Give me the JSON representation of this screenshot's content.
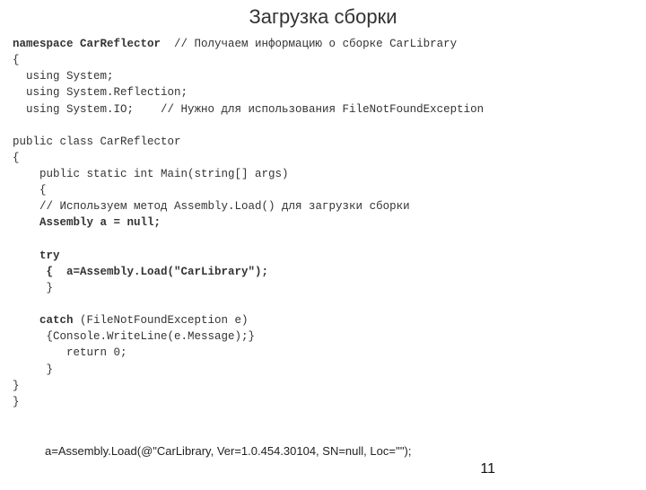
{
  "title": "Загрузка сборки",
  "code": {
    "l1a": "namespace CarReflector",
    "l1b": "  // Получаем информацию о сборке CarLibrary",
    "l2": "{",
    "l3": "  using System;",
    "l4": "  using System.Reflection;",
    "l5": "  using System.IO;    // Нужно для использования FileNotFoundException",
    "l6": "",
    "l7": "public class CarReflector",
    "l8": "{",
    "l9": "    public static int Main(string[] args)",
    "l10": "    {",
    "l11": "    // Используем метод Assembly.Load() для загрузки сборки",
    "l12": "    Assembly a = null;",
    "l13": "",
    "l14": "    try",
    "l15": "     {  a=Assembly.Load(\"CarLibrary\");",
    "l16": "     }",
    "l17": "",
    "l18": "    catch",
    "l18b": " (FileNotFoundException e)",
    "l19": "     {Console.WriteLine(e.Message);}",
    "l20": "        return 0;",
    "l21": "     }",
    "l22": "}",
    "l23": "}"
  },
  "footnote": "a=Assembly.Load(@\"CarLibrary, Ver=1.0.454.30104, SN=null, Loc=''\");",
  "pagenum": "11"
}
